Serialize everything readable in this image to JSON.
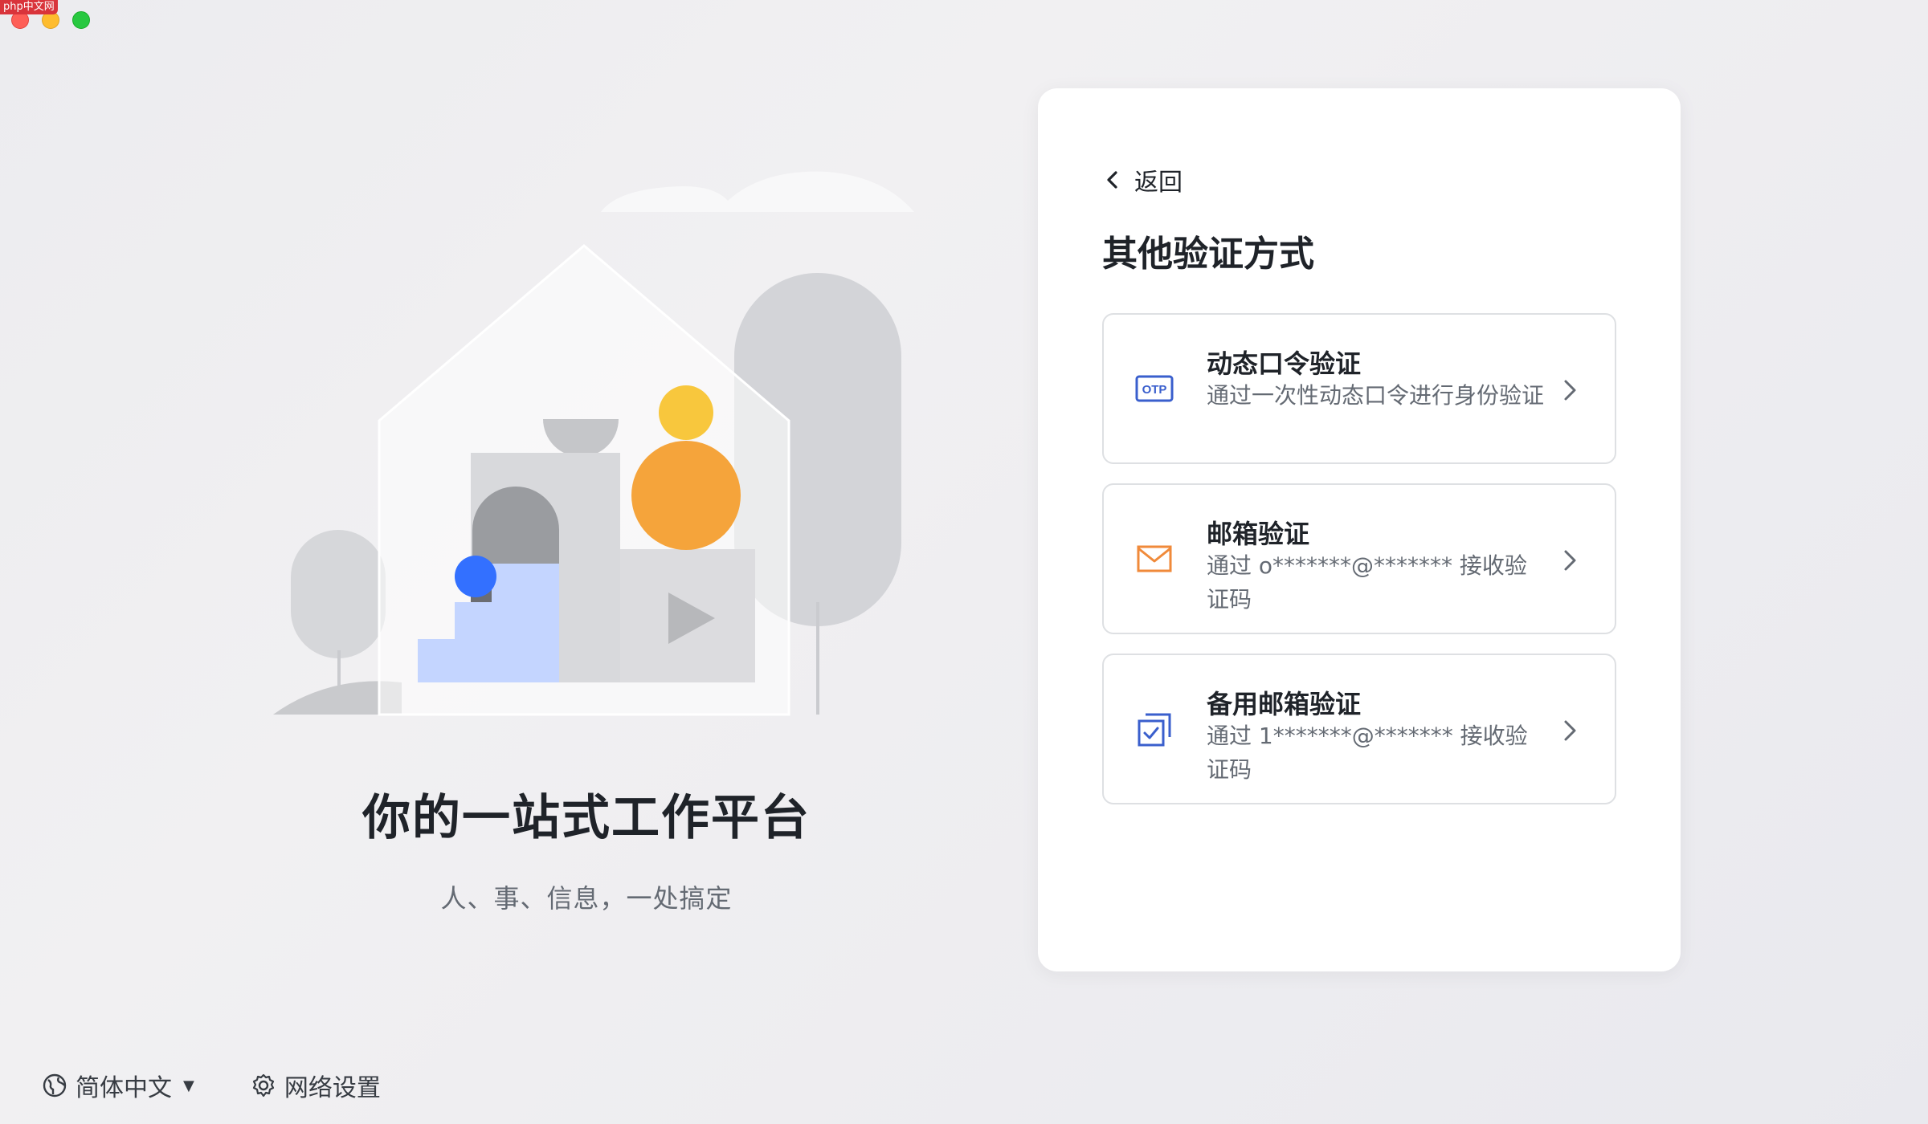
{
  "watermark": "php中文网",
  "left": {
    "slogan": "你的一站式工作平台",
    "sub_slogan": "人、事、信息，一处搞定"
  },
  "footer": {
    "language": "简体中文",
    "network": "网络设置"
  },
  "card": {
    "back_label": "返回",
    "title": "其他验证方式",
    "options": [
      {
        "title": "动态口令验证",
        "desc": "通过一次性动态口令进行身份验证",
        "icon": "otp-icon",
        "otp_text": "OTP"
      },
      {
        "title": "邮箱验证",
        "desc": "通过 o*******@******* 接收验证码",
        "icon": "mail-icon"
      },
      {
        "title": "备用邮箱验证",
        "desc": "通过 1*******@******* 接收验证码",
        "icon": "backup-mail-icon"
      }
    ]
  },
  "colors": {
    "accent_blue": "#3370ff",
    "orange": "#f5a43b",
    "yellow": "#f8c73d",
    "light_blue": "#c4d5ff"
  }
}
